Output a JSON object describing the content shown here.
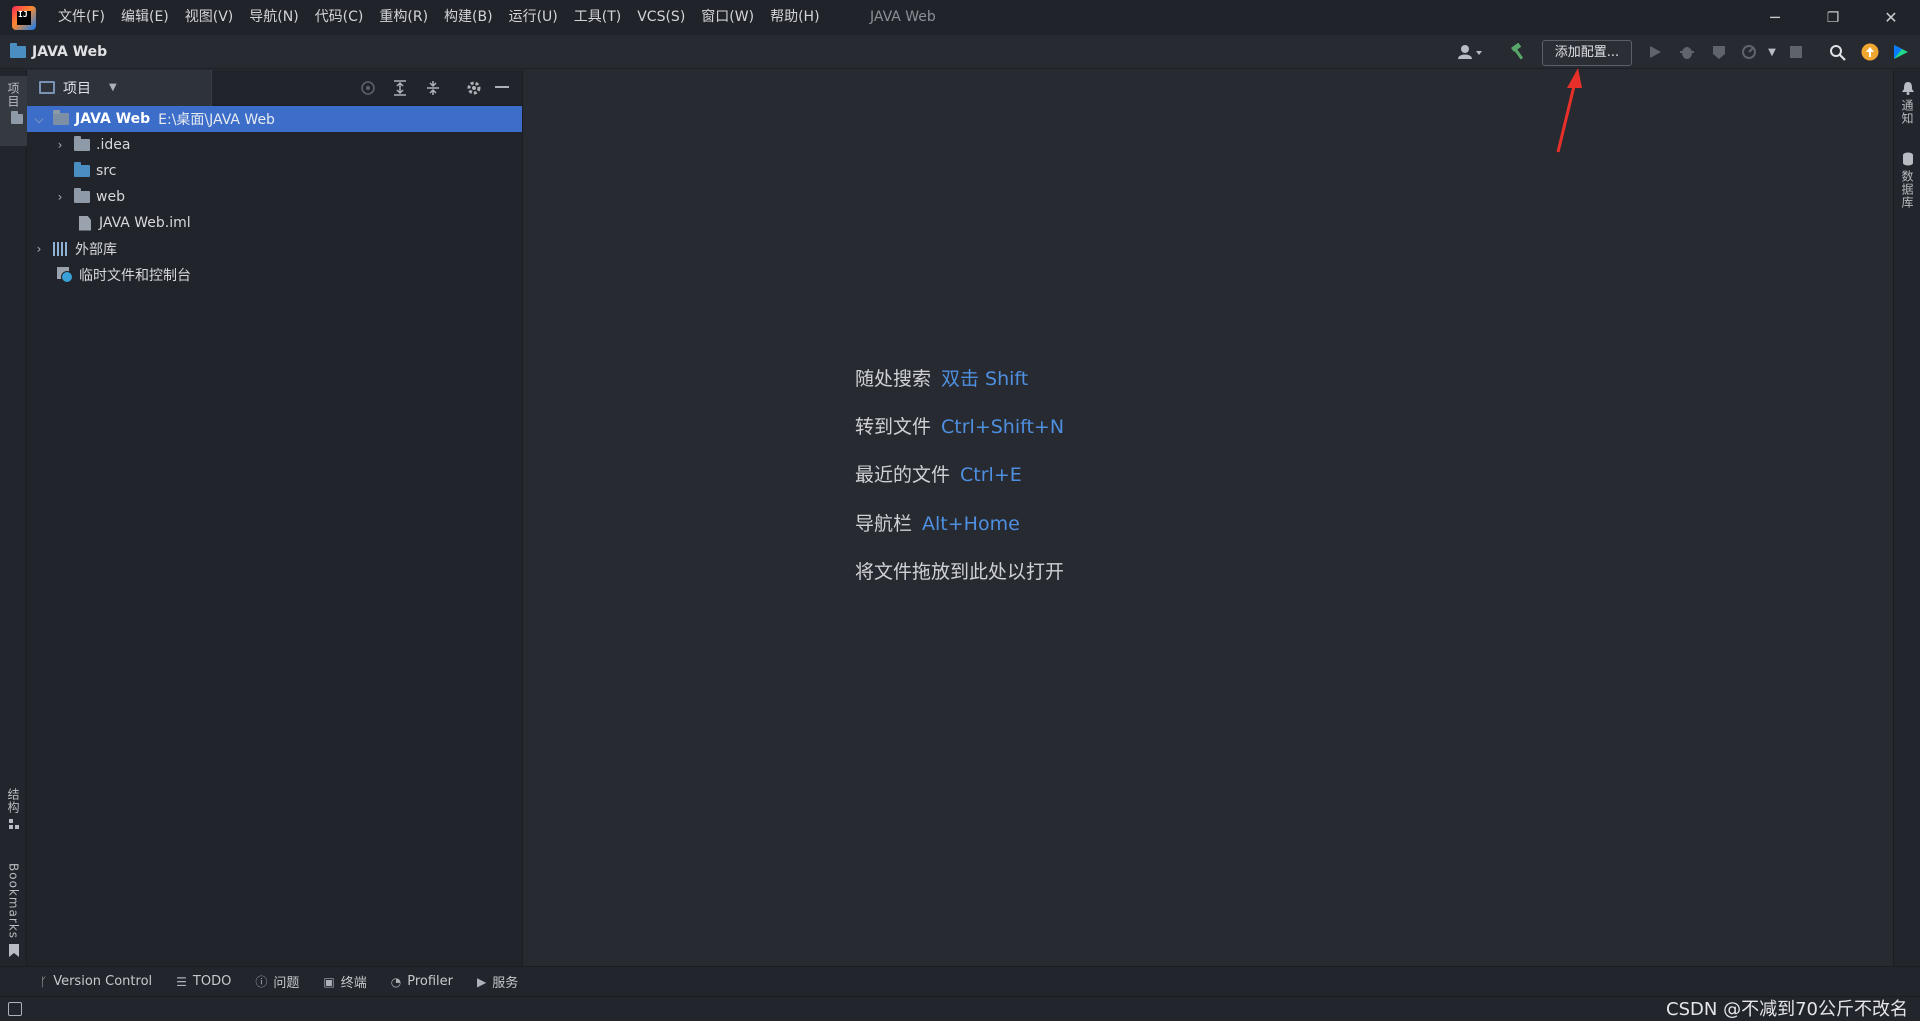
{
  "window": {
    "title": "JAVA Web",
    "menu": [
      "文件(F)",
      "编辑(E)",
      "视图(V)",
      "导航(N)",
      "代码(C)",
      "重构(R)",
      "构建(B)",
      "运行(U)",
      "工具(T)",
      "VCS(S)",
      "窗口(W)",
      "帮助(H)"
    ],
    "controls": {
      "minimize": "─",
      "restore": "❐",
      "close": "✕"
    }
  },
  "navbar": {
    "project_name": "JAVA Web",
    "add_config_label": "添加配置..."
  },
  "left_strip": {
    "project_tab": "项目",
    "structure_tab": "结构",
    "bookmarks_tab": "Bookmarks"
  },
  "right_strip": {
    "notifications_tab": "通知",
    "database_tab": "数据库"
  },
  "project_panel": {
    "tab_label": "项目",
    "tree": [
      {
        "label": "JAVA Web",
        "path": "E:\\桌面\\JAVA Web",
        "expanded": true,
        "selected": true
      },
      {
        "label": ".idea",
        "expanded": false
      },
      {
        "label": "src"
      },
      {
        "label": "web",
        "expanded": false
      },
      {
        "label": "JAVA Web.iml"
      },
      {
        "label": "外部库",
        "expanded": false
      },
      {
        "label": "临时文件和控制台"
      }
    ]
  },
  "editor_hints": [
    {
      "text": "随处搜索",
      "key": "双击 Shift"
    },
    {
      "text": "转到文件",
      "key": "Ctrl+Shift+N"
    },
    {
      "text": "最近的文件",
      "key": "Ctrl+E"
    },
    {
      "text": "导航栏",
      "key": "Alt+Home"
    },
    {
      "text": "将文件拖放到此处以打开",
      "key": ""
    }
  ],
  "bottom_tabs": [
    "Version Control",
    "TODO",
    "问题",
    "终端",
    "Profiler",
    "服务"
  ],
  "watermark": "CSDN @不减到70公斤不改名",
  "colors": {
    "accent": "#4e8fe0",
    "selection": "#3c6ec9",
    "annotation_arrow": "#e8302a"
  }
}
